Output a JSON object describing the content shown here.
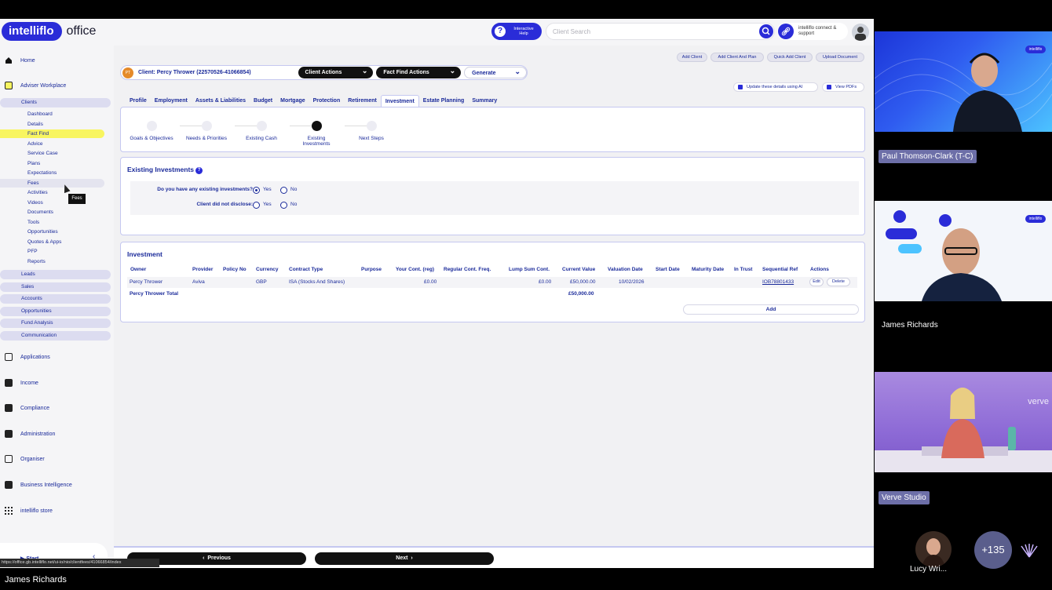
{
  "app": {
    "logo_brand": "intelliflo",
    "logo_product": "office",
    "help_label": "Interactive Help",
    "search_placeholder": "Client Search",
    "connect_label": "intelliflo connect & support"
  },
  "sidebar": {
    "main": [
      {
        "label": "Home"
      },
      {
        "label": "Adviser Workplace"
      }
    ],
    "sections": [
      {
        "label": "Clients"
      },
      {
        "label": "Leads"
      },
      {
        "label": "Sales"
      },
      {
        "label": "Accounts"
      },
      {
        "label": "Opportunities"
      },
      {
        "label": "Fund Analysis"
      },
      {
        "label": "Communication"
      }
    ],
    "client_items": [
      "Dashboard",
      "Details",
      "Fact Find",
      "Advice",
      "Service Case",
      "Plans",
      "Expectations",
      "Fees",
      "Activities",
      "Videos",
      "Documents",
      "Tools",
      "Opportunities",
      "Quotes & Apps",
      "PFP",
      "Reports"
    ],
    "bottom_main": [
      "Applications",
      "Income",
      "Compliance",
      "Administration",
      "Organiser",
      "Business Intelligence",
      "intelliflo store"
    ],
    "tooltip": "Fees",
    "start_label": "Start",
    "url_status": "https://office.gb.intelliflo.net/ui-io/nio/clientfees/41066854/index"
  },
  "actions": [
    "Add Client",
    "Add Client And Plan",
    "Quick Add Client",
    "Upload Document"
  ],
  "client_bar": {
    "initials": "PT",
    "client": "Client: Percy Thrower (22570526-41066854)",
    "client_actions": "Client Actions",
    "fact_find_actions": "Fact Find Actions",
    "generate": "Generate"
  },
  "ai_buttons": [
    "Update these details using AI",
    "View PDFs"
  ],
  "tabs": [
    "Profile",
    "Employment",
    "Assets & Liabilities",
    "Budget",
    "Mortgage",
    "Protection",
    "Retirement",
    "Investment",
    "Estate Planning",
    "Summary"
  ],
  "steps": [
    {
      "label": "Goals & Objectives"
    },
    {
      "label": "Needs & Priorities"
    },
    {
      "label": "Existing Cash"
    },
    {
      "label": "Existing Investments"
    },
    {
      "label": "Next Steps"
    }
  ],
  "existing_investments": {
    "title": "Existing Investments",
    "q1": "Do you have any existing investments?",
    "q2": "Client did not disclose:",
    "yes": "Yes",
    "no": "No"
  },
  "investment": {
    "title": "Investment",
    "headers": [
      "Owner",
      "Provider",
      "Policy No",
      "Currency",
      "Contract Type",
      "Purpose",
      "Your Cont. (reg)",
      "Regular Cont. Freq.",
      "Lump Sum Cont.",
      "Current Value",
      "Valuation Date",
      "Start Date",
      "Maturity Date",
      "In Trust",
      "Sequential Ref",
      "Actions"
    ],
    "row": {
      "owner": "Percy Thrower",
      "provider": "Aviva",
      "currency": "GBP",
      "contract_type": "ISA (Stocks And Shares)",
      "your_cont": "£0.00",
      "lump_sum": "£0.00",
      "current_value": "£50,000.00",
      "valuation_date": "10/02/2026",
      "seq_ref": "IOB78801433",
      "edit": "Edit",
      "delete": "Delete"
    },
    "total_label": "Percy Thrower Total",
    "total_value": "£50,000.00",
    "add": "Add"
  },
  "footer": {
    "previous": "Previous",
    "next": "Next"
  },
  "video": {
    "p1": "Paul Thomson-Clark (T-C)",
    "p2": "James Richards",
    "p3": "Verve Studio",
    "p4": "Lucy Wri...",
    "more": "+135",
    "chip": "intelliflo",
    "verve": "verve",
    "bottom_name": "James Richards"
  }
}
